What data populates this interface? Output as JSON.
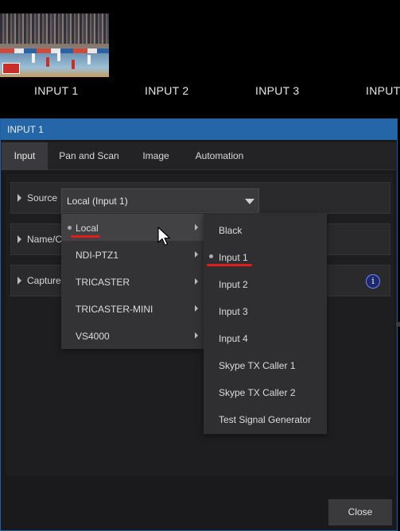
{
  "inputs": [
    {
      "label": "INPUT 1",
      "has_preview": true
    },
    {
      "label": "INPUT 2",
      "has_preview": false
    },
    {
      "label": "INPUT 3",
      "has_preview": false
    },
    {
      "label": "INPUT",
      "has_preview": false
    }
  ],
  "dialog": {
    "title": "INPUT 1",
    "tabs": [
      {
        "label": "Input",
        "active": true
      },
      {
        "label": "Pan and Scan",
        "active": false
      },
      {
        "label": "Image",
        "active": false
      },
      {
        "label": "Automation",
        "active": false
      }
    ],
    "rows": [
      {
        "label": "Source"
      },
      {
        "label": "Name/C"
      },
      {
        "label": "Capture"
      }
    ],
    "source_value": "Local (Input 1)",
    "close_label": "Close"
  },
  "source_menu": {
    "items": [
      {
        "label": "Local",
        "selected": true,
        "hovered": true
      },
      {
        "label": "NDI-PTZ1",
        "selected": false
      },
      {
        "label": "TRICASTER",
        "selected": false
      },
      {
        "label": "TRICASTER-MINI",
        "selected": false
      },
      {
        "label": "VS4000",
        "selected": false
      }
    ]
  },
  "local_submenu": {
    "items": [
      {
        "label": "Black",
        "selected": false
      },
      {
        "label": "Input 1",
        "selected": true
      },
      {
        "label": "Input 2",
        "selected": false
      },
      {
        "label": "Input 3",
        "selected": false
      },
      {
        "label": "Input 4",
        "selected": false
      },
      {
        "label": "Skype TX Caller 1",
        "selected": false
      },
      {
        "label": "Skype TX Caller 2",
        "selected": false
      },
      {
        "label": "Test Signal Generator",
        "selected": false
      }
    ]
  },
  "colors": {
    "titlebar": "#2566a8",
    "annotation": "#e21b1b",
    "info_accent": "#6a86ff"
  },
  "icons": {
    "cursor": "mouse-pointer-icon",
    "info": "info-icon",
    "expand": "expand-caret-icon",
    "dropdown": "dropdown-arrow-icon",
    "submenu": "submenu-arrow-icon"
  }
}
